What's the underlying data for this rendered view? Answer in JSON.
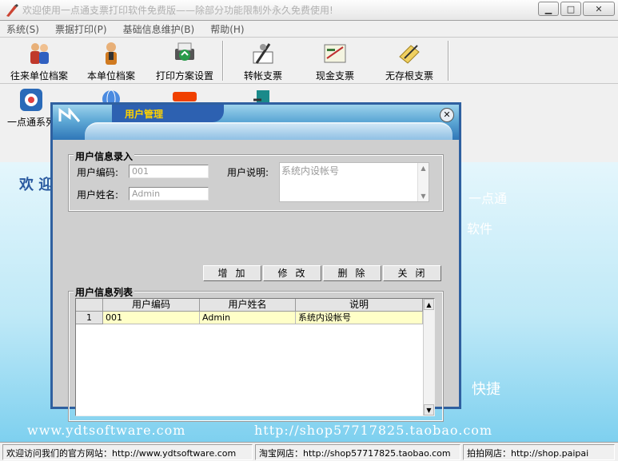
{
  "window": {
    "title": "欢迎使用一点通支票打印软件免费版——除部分功能限制外永久免费使用!",
    "minimize": "▁",
    "maximize": "□",
    "close": "✕"
  },
  "menu": [
    "系统(S)",
    "票据打印(P)",
    "基础信息维护(B)",
    "帮助(H)"
  ],
  "toolbar": {
    "items": [
      {
        "label": "往来单位档案",
        "icon": "people-icon"
      },
      {
        "label": "本单位档案",
        "icon": "person-icon"
      },
      {
        "label": "打印方案设置",
        "icon": "print-settings-icon"
      },
      {
        "label": "转帐支票",
        "icon": "transfer-check-icon"
      },
      {
        "label": "现金支票",
        "icon": "cash-check-icon"
      },
      {
        "label": "无存根支票",
        "icon": "stubless-check-icon"
      }
    ],
    "row2": [
      {
        "label": "一点通系列",
        "icon": "series-icon"
      }
    ]
  },
  "background": {
    "welcome": "欢 迎",
    "right_text_1": "一点通",
    "right_text_2": "软件",
    "right_text_3": "快捷",
    "url_left": "www.ydtsoftware.com",
    "url_right": "http://shop57717825.taobao.com"
  },
  "dialog": {
    "title": "用户管理",
    "close": "✕",
    "entry_group": "用户信息录入",
    "user_code_label": "用户编码:",
    "user_code_value": "001",
    "user_name_label": "用户姓名:",
    "user_name_value": "Admin",
    "desc_label": "用户说明:",
    "desc_value": "系统内设帐号",
    "buttons": {
      "add": "增加",
      "edit": "修改",
      "delete": "删除",
      "close": "关闭"
    },
    "list_group": "用户信息列表",
    "columns": [
      "用户编码",
      "用户姓名",
      "说明"
    ],
    "rows": [
      {
        "no": "1",
        "code": "001",
        "name": "Admin",
        "desc": "系统内设帐号"
      }
    ]
  },
  "status": {
    "seg1": "欢迎访问我们的官方网站：http://www.ydtsoftware.com",
    "seg2": "淘宝网店：http://shop57717825.taobao.com",
    "seg3": "拍拍网店：http://shop.paipai"
  },
  "colors": {
    "dialog_border": "#2f60a0",
    "dialog_title_text": "#ffd200",
    "selected_row": "#ffffc8"
  }
}
